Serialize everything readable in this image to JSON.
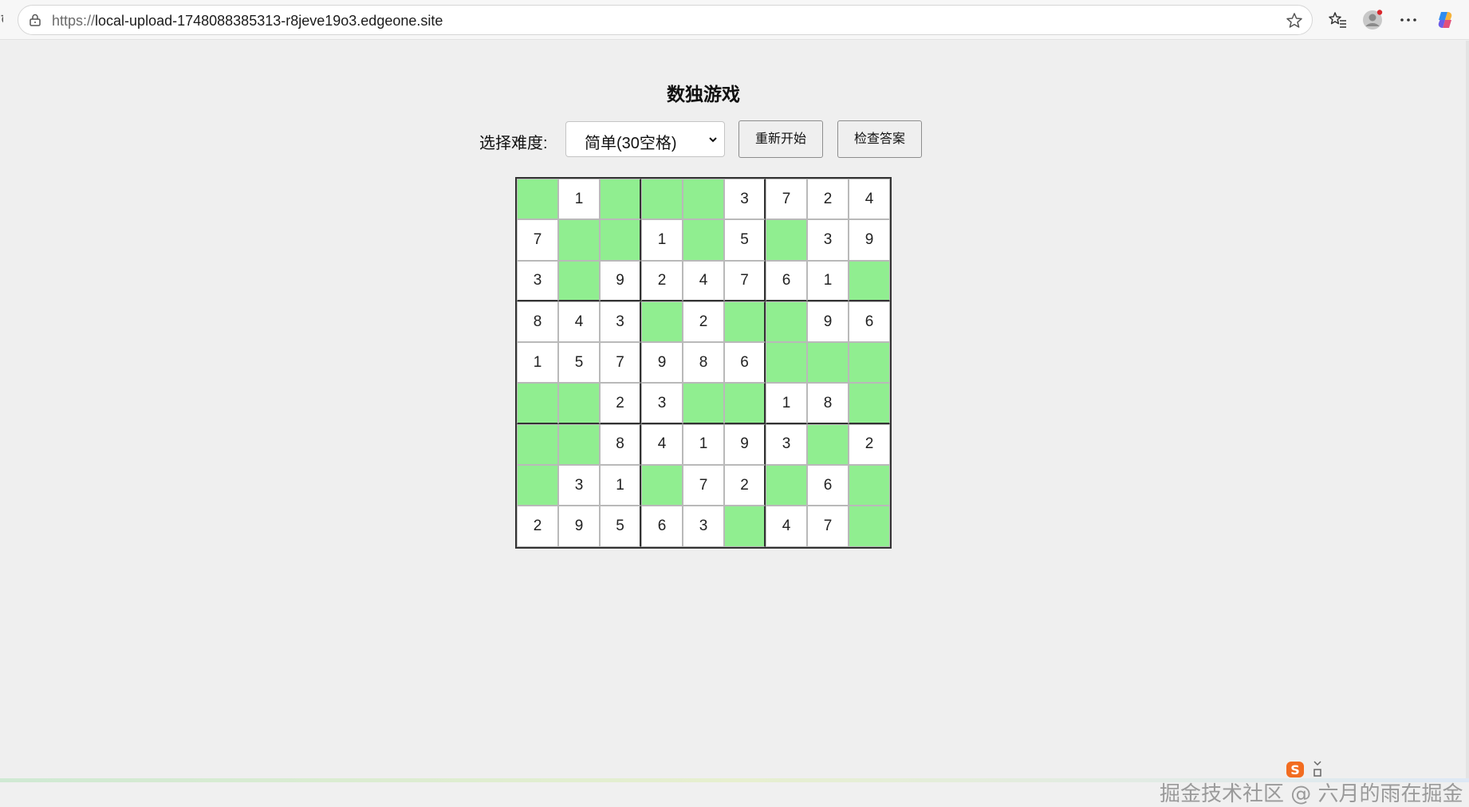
{
  "browser": {
    "url_scheme": "https://",
    "url_host": "local-upload-1748088385313-r8jeve19o3.edgeone.site",
    "icons": [
      "lock-icon",
      "star-icon",
      "favorites-icon",
      "profile-icon",
      "more-icon",
      "copilot-icon"
    ]
  },
  "app": {
    "title": "数独游戏",
    "difficulty_label": "选择难度:",
    "difficulty_selected": "简单(30空格)",
    "restart_label": "重新开始",
    "check_label": "检查答案"
  },
  "colors": {
    "empty_cell": "#90ee90",
    "filled_cell": "#ffffff",
    "page_bg": "#efefef"
  },
  "board": [
    [
      "",
      "1",
      "",
      "",
      "",
      "3",
      "7",
      "2",
      "4"
    ],
    [
      "7",
      "",
      "",
      "1",
      "",
      "5",
      "",
      "3",
      "9"
    ],
    [
      "3",
      "",
      "9",
      "2",
      "4",
      "7",
      "6",
      "1",
      ""
    ],
    [
      "8",
      "4",
      "3",
      "",
      "2",
      "",
      "",
      "9",
      "6"
    ],
    [
      "1",
      "5",
      "7",
      "9",
      "8",
      "6",
      "",
      "",
      ""
    ],
    [
      "",
      "",
      "2",
      "3",
      "",
      "",
      "1",
      "8",
      ""
    ],
    [
      "",
      "",
      "8",
      "4",
      "1",
      "9",
      "3",
      "",
      "2"
    ],
    [
      "",
      "3",
      "1",
      "",
      "7",
      "2",
      "",
      "6",
      ""
    ],
    [
      "2",
      "9",
      "5",
      "6",
      "3",
      "",
      "4",
      "7",
      ""
    ]
  ],
  "watermark": "掘金技术社区 @ 六月的雨在掘金"
}
